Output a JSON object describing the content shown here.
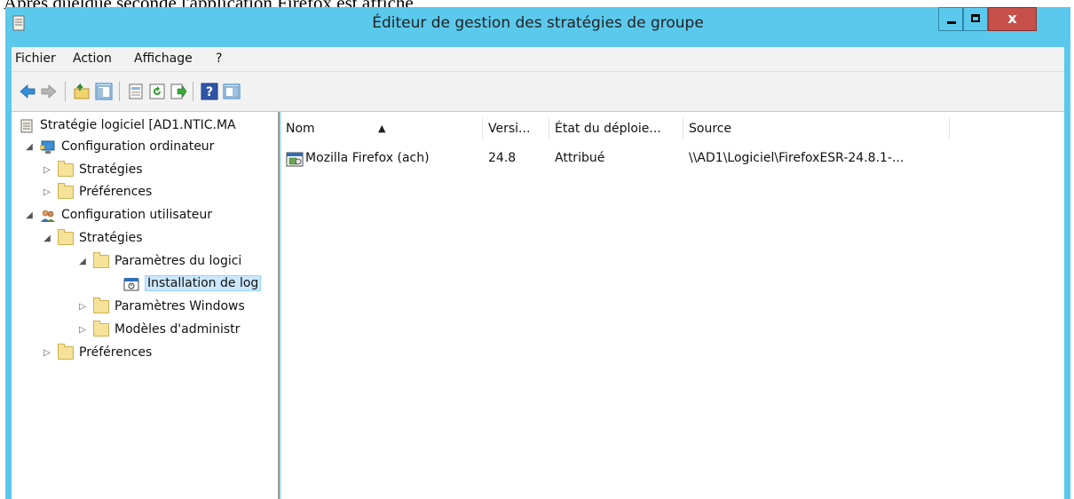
{
  "caption": "Après quelque seconde l'application Firefox est affiché",
  "window": {
    "title": "Éditeur de gestion des stratégies de groupe",
    "close_label": "x"
  },
  "menu": [
    "Fichier",
    "Action",
    "Affichage",
    "?"
  ],
  "toolbar": {
    "icons": [
      "back-arrow-icon",
      "forward-arrow-icon",
      "up-folder-icon",
      "show-hide-tree-icon",
      "properties-icon",
      "refresh-icon",
      "export-list-icon",
      "help-icon",
      "show-hide-action-pane-icon"
    ]
  },
  "tree": {
    "root": "Stratégie logiciel [AD1.NTIC.MA",
    "computer_config": "Configuration ordinateur",
    "computer_policies": "Stratégies",
    "computer_prefs": "Préférences",
    "user_config": "Configuration utilisateur",
    "user_policies": "Stratégies",
    "software_settings": "Paramètres du logici",
    "software_install": "Installation de log",
    "windows_settings": "Paramètres Windows",
    "admin_templates": "Modèles d'administr",
    "user_prefs": "Préférences"
  },
  "list": {
    "columns": [
      "Nom",
      "Versi...",
      "État du déploie...",
      "Source"
    ],
    "rows": [
      {
        "name": "Mozilla Firefox (ach)",
        "version": "24.8",
        "state": "Attribué",
        "source": "\\\\AD1\\Logiciel\\FirefoxESR-24.8.1-..."
      }
    ]
  },
  "colors": {
    "window_frame": "#5bc9ec",
    "close_button": "#c7504a",
    "selection": "#cce8ff"
  }
}
